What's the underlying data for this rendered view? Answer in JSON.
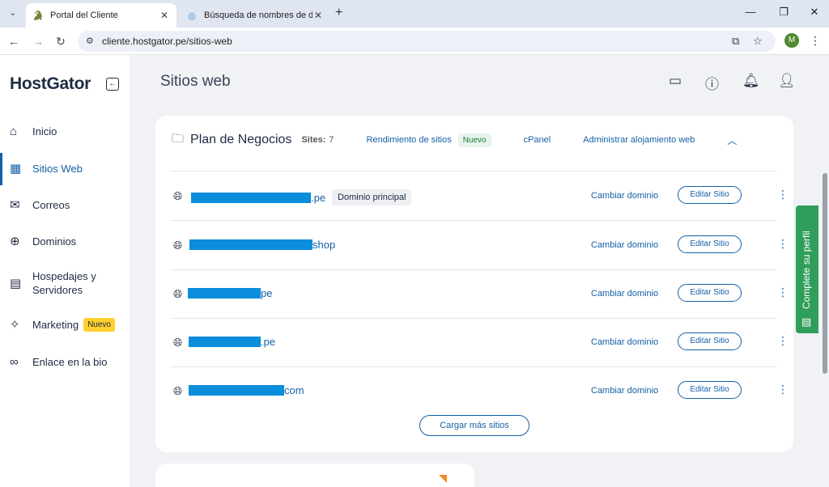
{
  "browser": {
    "tabs": [
      {
        "title": "Portal del Cliente",
        "active": true
      },
      {
        "title": "Búsqueda de nombres de dom",
        "active": false
      }
    ],
    "url": "cliente.hostgator.pe/sitios-web",
    "profile_initial": "M"
  },
  "sidebar": {
    "logo": "HostGator",
    "items": [
      {
        "label": "Inicio",
        "icon": "home-icon"
      },
      {
        "label": "Sitios Web",
        "icon": "layout-icon",
        "active": true
      },
      {
        "label": "Correos",
        "icon": "mail-icon"
      },
      {
        "label": "Dominios",
        "icon": "globe-icon"
      },
      {
        "label": "Hospedajes y Servidores",
        "line1": "Hospedajes y",
        "line2": "Servidores",
        "icon": "server-icon"
      },
      {
        "label": "Marketing",
        "icon": "sparkle-icon",
        "badge": "Nuevo"
      },
      {
        "label": "Enlace en la bio",
        "icon": "link-icon"
      }
    ]
  },
  "header": {
    "title": "Sitios web"
  },
  "plan": {
    "name": "Plan de Negocios",
    "sites_label": "Sites:",
    "sites_count": "7",
    "performance_link": "Rendimiento de sitios",
    "performance_badge": "Nuevo",
    "cpanel_link": "cPanel",
    "manage_link": "Administrar alojamiento web"
  },
  "sites": [
    {
      "suffix": ".pe",
      "primary_badge": "Dominio principal"
    },
    {
      "suffix": "shop"
    },
    {
      "suffix": "pe"
    },
    {
      "suffix": ".pe"
    },
    {
      "suffix": "com"
    }
  ],
  "actions": {
    "change_domain": "Cambiar dominio",
    "edit_site": "Editar Sitio",
    "load_more": "Cargar más sitios"
  },
  "side_tab": {
    "label": "Complete su perfil"
  },
  "colors": {
    "brand_blue": "#1560a6",
    "redaction": "#0a8ddb",
    "badge_yellow": "#ffcf2e",
    "side_tab_green": "#2f9e5a"
  }
}
